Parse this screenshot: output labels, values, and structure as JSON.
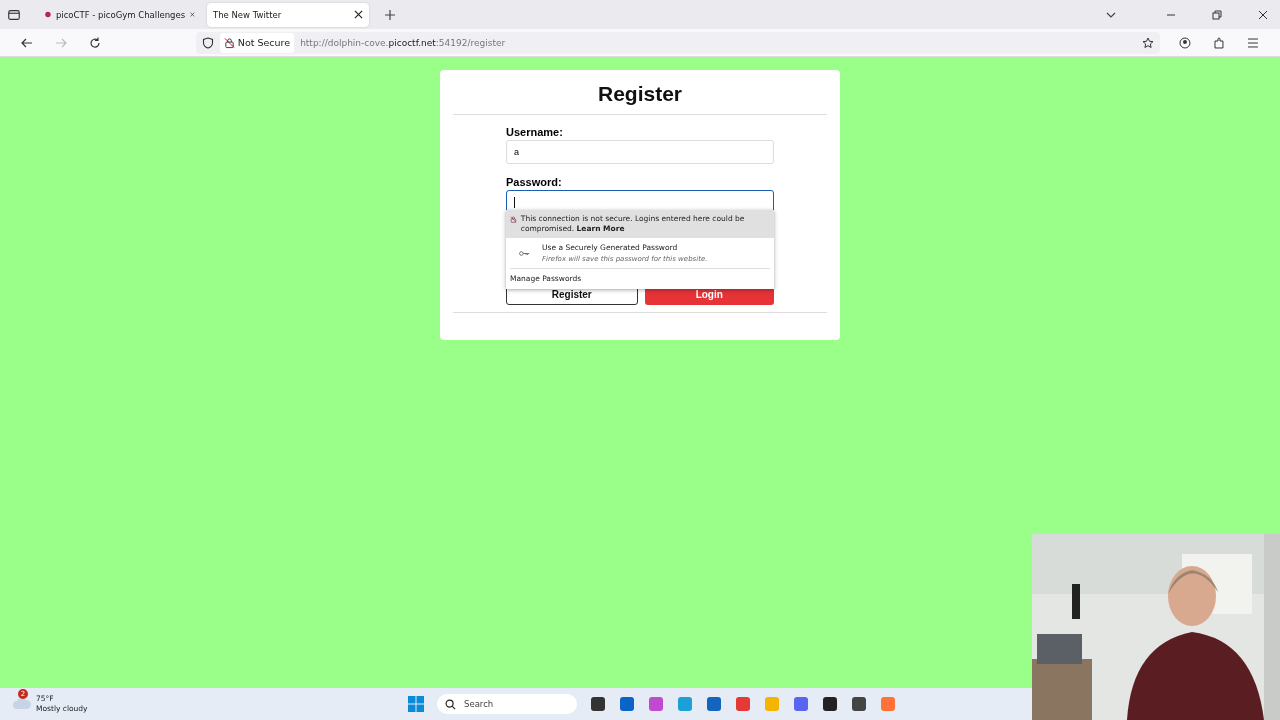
{
  "browser": {
    "tabs": [
      {
        "title": "picoCTF - picoGym Challenges",
        "selected": false
      },
      {
        "title": "The New Twitter",
        "selected": true
      }
    ],
    "security_label": "Not Secure",
    "url": {
      "prefix": "http://dolphin-cove.",
      "domain": "picoctf.net",
      "suffix": ":54192/register"
    }
  },
  "page": {
    "title": "Register",
    "fields": [
      {
        "label": "Username:",
        "value": "a",
        "focused": false
      },
      {
        "label": "Password:",
        "focused": true
      }
    ],
    "buttons": [
      {
        "label": "Register",
        "kind": "secondary"
      },
      {
        "label": "Login",
        "kind": "primary"
      }
    ]
  },
  "autocomplete": {
    "warning": "This connection is not secure. Logins entered here could be compromised. **Learn More**",
    "generate": "Use a Securely Generated Password",
    "generate_note": "Firefox will save this password for this website.",
    "manage": "Manage Passwords"
  },
  "taskbar": {
    "weather_badge": "2",
    "temperature": "75°F",
    "weather": "Mostly cloudy",
    "search_placeholder": "Search"
  }
}
